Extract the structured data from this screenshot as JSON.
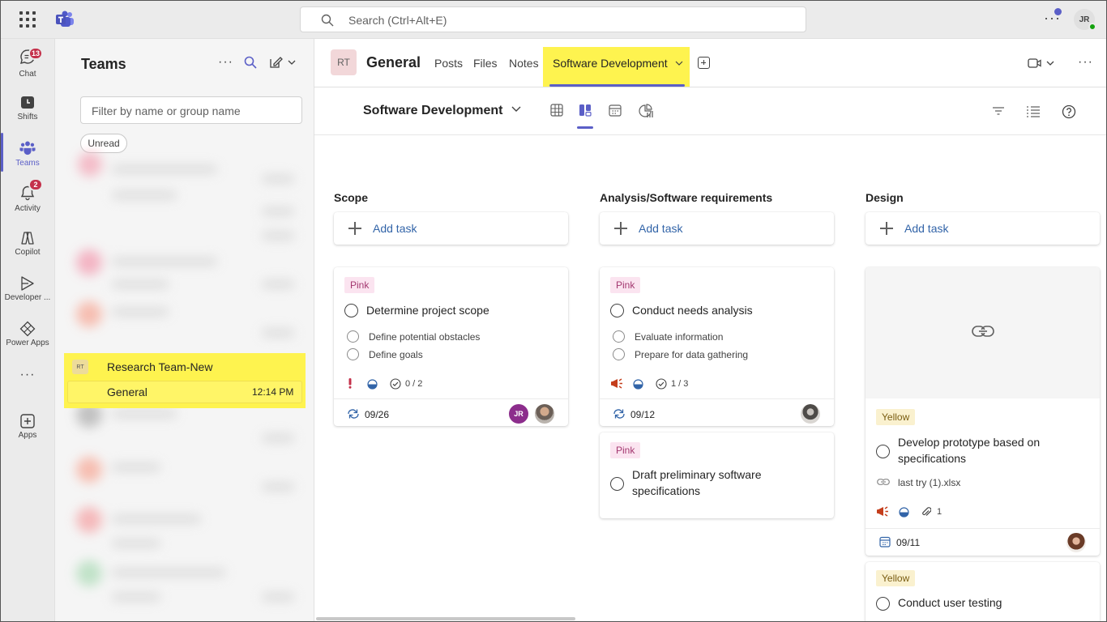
{
  "topbar": {
    "search_placeholder": "Search (Ctrl+Alt+E)",
    "more": "···",
    "user_initials": "JR"
  },
  "rail": {
    "items": [
      {
        "label": "Chat",
        "icon": "chat-icon",
        "badge": "13"
      },
      {
        "label": "Shifts",
        "icon": "shifts-icon"
      },
      {
        "label": "Teams",
        "icon": "teams-icon"
      },
      {
        "label": "Activity",
        "icon": "bell-icon",
        "badge": "2"
      },
      {
        "label": "Copilot",
        "icon": "copilot-icon"
      },
      {
        "label": "Developer ...",
        "icon": "developer-portal-icon"
      },
      {
        "label": "Power Apps",
        "icon": "power-apps-icon"
      },
      {
        "label": "···",
        "icon": "more-icon"
      },
      {
        "label": "Apps",
        "icon": "apps-plus-icon"
      }
    ],
    "accent": "#5b5fc7"
  },
  "list": {
    "title": "Teams",
    "more": "···",
    "filter_placeholder": "Filter by name or group name",
    "chip": "Unread",
    "team_initials": "RT",
    "team_name": "Research Team-New",
    "channel_name": "General",
    "channel_time": "12:14 PM"
  },
  "channel": {
    "initials": "RT",
    "name": "General",
    "tabs": [
      "Posts",
      "Files",
      "Notes"
    ],
    "active_tab": "Software Development",
    "more": "···"
  },
  "plan": {
    "title": "Software Development",
    "views": [
      "grid-view-icon",
      "board-view-icon",
      "schedule-view-icon",
      "charts-view-icon"
    ],
    "active_view": "board-view-icon"
  },
  "board": {
    "add_task": "Add task",
    "columns": [
      {
        "title": "Scope",
        "cards": [
          {
            "label": "Pink",
            "title": "Determine project scope",
            "checklist": [
              "Define potential obstacles",
              "Define goals"
            ],
            "priority": "important",
            "progress": "in progress",
            "checks": "0 / 2",
            "date": "09/26",
            "assignees": [
              "JR",
              "photo"
            ]
          }
        ]
      },
      {
        "title": "Analysis/Software requirements",
        "cards": [
          {
            "label": "Pink",
            "title": "Conduct needs analysis",
            "checklist": [
              "Evaluate information",
              "Prepare for data gathering"
            ],
            "priority": "urgent",
            "progress": "in progress",
            "checks": "1 / 3",
            "date": "09/12",
            "assignees": [
              "photo"
            ]
          },
          {
            "label": "Pink",
            "title": "Draft preliminary software specifications"
          }
        ]
      },
      {
        "title": "Design",
        "cards": [
          {
            "label": "Yellow",
            "title": "Develop prototype based on specifications",
            "attachment": "last try (1).xlsx",
            "priority": "urgent",
            "progress": "in progress",
            "attachments_count": "1",
            "date": "09/11",
            "assignees": [
              "photo"
            ]
          },
          {
            "label": "Yellow",
            "title": "Conduct user testing"
          }
        ]
      }
    ]
  },
  "colors": {
    "highlight": "#fef34f",
    "pink_label_bg": "#fbe4f0",
    "yellow_label_bg": "#faf1cf",
    "link_blue": "#3264a8"
  }
}
